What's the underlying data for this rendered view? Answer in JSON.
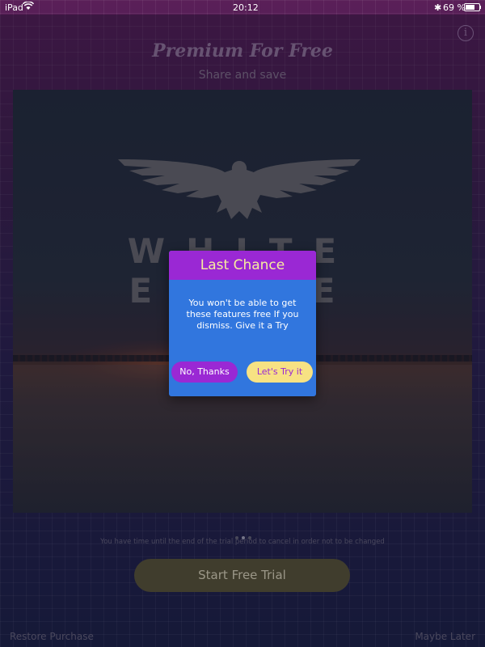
{
  "status_bar": {
    "device": "iPad",
    "time": "20:12",
    "battery": "69 %",
    "icons": [
      "wifi-icon",
      "bluetooth-icon",
      "battery-icon"
    ]
  },
  "header": {
    "title": "Premium For Free",
    "subtitle": "Share and save",
    "info_icon": "i"
  },
  "hero": {
    "brand_text": "WHITE EAGLE"
  },
  "pager": {
    "count": 3,
    "active_index": 1
  },
  "footer": {
    "trial_note": "You have time until the end of the trial period to cancel in order not to be changed",
    "start_button": "Start Free Trial",
    "restore": "Restore Purchase",
    "maybe_later": "Maybe Later"
  },
  "dialog": {
    "title": "Last Chance",
    "message": "You won't be able to get these features free If you dismiss. Give it a Try",
    "decline": "No, Thanks",
    "accept": "Let's Try it"
  },
  "colors": {
    "dialog_bg": "#3176de",
    "dialog_header": "#9a28d4",
    "accent_yellow": "#f7e283"
  }
}
